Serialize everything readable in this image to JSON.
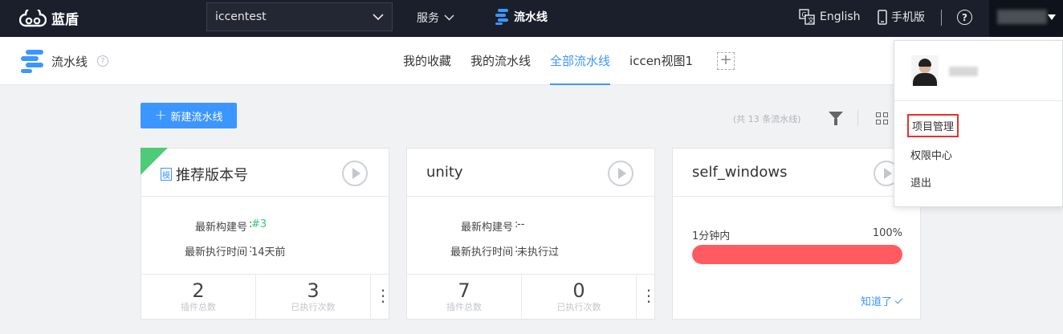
{
  "topbar": {
    "brand": "蓝盾",
    "project": "iccentest",
    "service_label": "服务",
    "pipeline_label": "流水线",
    "lang_label": "English",
    "mobile_label": "手机版",
    "help": "?"
  },
  "subheader": {
    "title": "流水线",
    "tabs": [
      {
        "label": "我的收藏",
        "active": false
      },
      {
        "label": "我的流水线",
        "active": false
      },
      {
        "label": "全部流水线",
        "active": true
      },
      {
        "label": "iccen视图1",
        "active": false
      }
    ],
    "add_tab": "+"
  },
  "toolbar": {
    "new_pipeline": "新建流水线",
    "count_text": "(共 13 条流水线)"
  },
  "cards": [
    {
      "title": "推荐版本号",
      "badge": "模",
      "build_label": "最新构建号",
      "build_value": "#3",
      "exec_label": "最新执行时间",
      "exec_value": "14天前",
      "plugins": "2",
      "plugins_label": "插件总数",
      "runs": "3",
      "runs_label": "已执行次数"
    },
    {
      "title": "unity",
      "build_label": "最新构建号",
      "build_value": "--",
      "exec_label": "最新执行时间",
      "exec_value": "未执行过",
      "plugins": "7",
      "plugins_label": "插件总数",
      "runs": "0",
      "runs_label": "已执行次数"
    },
    {
      "title": "self_windows",
      "progress_label": "1分钟内",
      "progress_value": "100%",
      "progress_fraction": 1.0,
      "ack_label": "知道了"
    }
  ],
  "dropdown": {
    "items": [
      "项目管理",
      "权限中心",
      "退出"
    ]
  },
  "colors": {
    "accent": "#3c96ff",
    "success": "#2dcb74",
    "progress": "#ff5b61",
    "topbar": "#1a1f2b"
  }
}
